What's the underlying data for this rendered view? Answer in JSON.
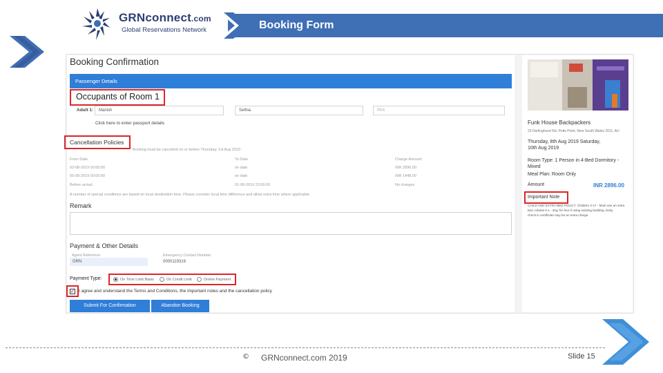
{
  "slide": {
    "title": "Booking Form",
    "logo_main": "GRNconnect",
    "logo_com": ".com",
    "logo_sub": "Global Reservations Network",
    "footer": "GRNconnect.com 2019",
    "copyright_icon": "©",
    "slide_number": "Slide 15",
    "colors": {
      "header": "#3f6fb5",
      "accent_blue": "#2f7ed8",
      "highlight_red": "#d9262b",
      "logo_navy": "#2c3f72"
    }
  },
  "form": {
    "page_title": "Booking Confirmation",
    "passenger_bar": "Passenger Details",
    "occupants_title": "Occupants of Room 1",
    "adult_label": "Adult 1:",
    "first_name": "Manish",
    "last_name": "Sethia",
    "pax_type": "PAX",
    "passport_link": "Click here to enter passport details",
    "cancellation": {
      "title": "Cancellation Policies",
      "note": "Booking must be cancelled on or before Thursday, 1st Aug 2019",
      "headers": [
        "From Date",
        "To Date",
        "Charge Amount"
      ],
      "rows": [
        [
          "03-08-2019 00:00:00",
          "on date",
          "INR 2896.00"
        ],
        [
          "05-08-2019 00:00:00",
          "on date",
          "INR 1448.00"
        ],
        [
          "Before arrival",
          "01-08-2019 23:59:00",
          "No charges"
        ]
      ],
      "footnote": "A number of special conditions are based on local destination time. Please consider local time difference and allow extra time where applicable."
    },
    "remark_label": "Remark",
    "payment": {
      "title": "Payment & Other Details",
      "agent_ref_label": "Agent Reference",
      "agent_ref_value": "GRN",
      "emergency_label": "Emergency Contact Number",
      "emergency_value": "0000119319",
      "type_label": "Payment Type:",
      "options": [
        "On Time Limit Basis",
        "On Credit Limit",
        "Online Payment"
      ],
      "selected_index": 0
    },
    "terms": "I agree and understand the Terms and Conditions, the important notes and the cancellation policy",
    "submit_label": "Submit For Confirmation",
    "abandon_label": "Abandon Booking"
  },
  "summary": {
    "hotel": "Funk House Backpackers",
    "address": "23 Darlinghurst Rd, Potts Point, New South Wales 2011, AU",
    "dates": [
      "Thursday, 8th Aug 2019 Saturday,",
      "10th Aug 2019"
    ],
    "room_type": [
      "Room Type: 1 Person in 4-Bed Dormitory -",
      "Mixed"
    ],
    "meal_plan": "Meal Plan: Room Only",
    "amount_label": "Amount",
    "amount_value": "INR 2896.00",
    "important_note_title": "Important Note",
    "important_note_lines": [
      "CHILD AND EXTRA BED POLICY: Children 2-17 - Must use an extra",
      "bed. Infants 0-1 - stay for free if using existing bedding. Early",
      "check in certificate may be an extra charge"
    ]
  }
}
